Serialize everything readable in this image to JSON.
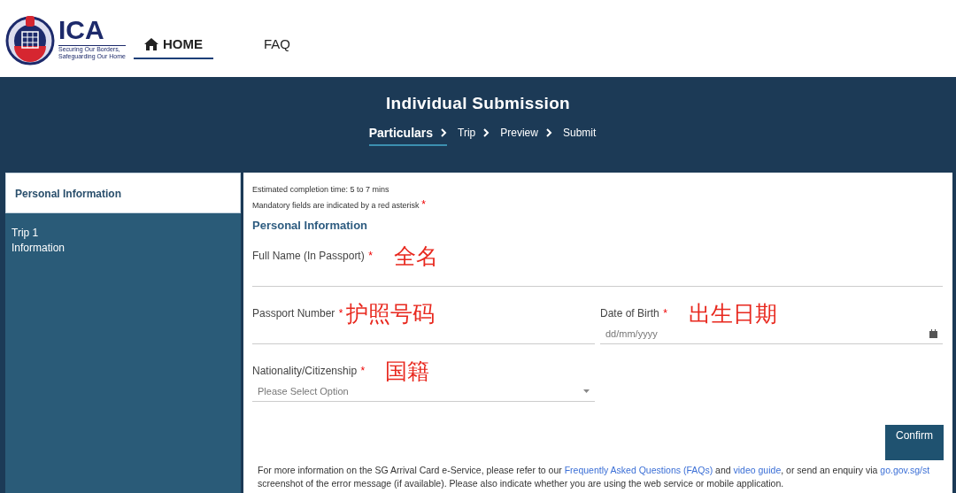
{
  "header": {
    "logo_text": "ICA",
    "logo_tagline": [
      "Securing Our Borders,",
      "Safeguarding Our Home"
    ],
    "nav": [
      {
        "label": "HOME",
        "selected": true
      },
      {
        "label": "FAQ",
        "selected": false
      }
    ]
  },
  "banner": {
    "title": "Individual Submission",
    "steps": [
      {
        "label": "Particulars",
        "selected": true
      },
      {
        "label": "Trip",
        "selected": false
      },
      {
        "label": "Preview",
        "selected": false
      },
      {
        "label": "Submit",
        "selected": false
      }
    ]
  },
  "sidebar": {
    "items": [
      {
        "label": "Personal Information",
        "selected": true
      },
      {
        "label": "Trip 1\nInformation",
        "selected": false
      }
    ]
  },
  "form": {
    "notes": [
      {
        "text": "Estimated completion time: 5 to 7 mins"
      },
      {
        "text": "Mandatory fields are indicated by a red asterisk",
        "mark": "*"
      }
    ],
    "section_title": "Personal Information",
    "fields": [
      {
        "kind": "text",
        "label": "Full Name (In Passport)",
        "required_mark": "*",
        "annotation": "全名",
        "wide": true
      },
      {
        "kind": "text",
        "label": "Passport Number",
        "required_mark": "*",
        "annotation": "护照号码"
      },
      {
        "kind": "date",
        "label": "Date of Birth",
        "required_mark": "*",
        "placeholder": "dd/mm/yyyy",
        "annotation": "出生日期"
      },
      {
        "kind": "select",
        "label": "Nationality/Citizenship",
        "required_mark": "*",
        "placeholder": "Please Select Option",
        "annotation": "国籍"
      }
    ],
    "confirm": "Confirm",
    "footer": {
      "parts": [
        {
          "kind": "text",
          "text": "For more information on the SG Arrival Card e-Service, please refer to our "
        },
        {
          "kind": "link",
          "text": "Frequently Asked Questions (FAQs)"
        },
        {
          "kind": "text",
          "text": " and "
        },
        {
          "kind": "link",
          "text": "video guide"
        },
        {
          "kind": "text",
          "text": ", or send an enquiry via "
        },
        {
          "kind": "link",
          "text": "go.gov.sg/st"
        }
      ],
      "line2": "screenshot of the error message (if available). Please also indicate whether you are using the web service or mobile application."
    }
  }
}
